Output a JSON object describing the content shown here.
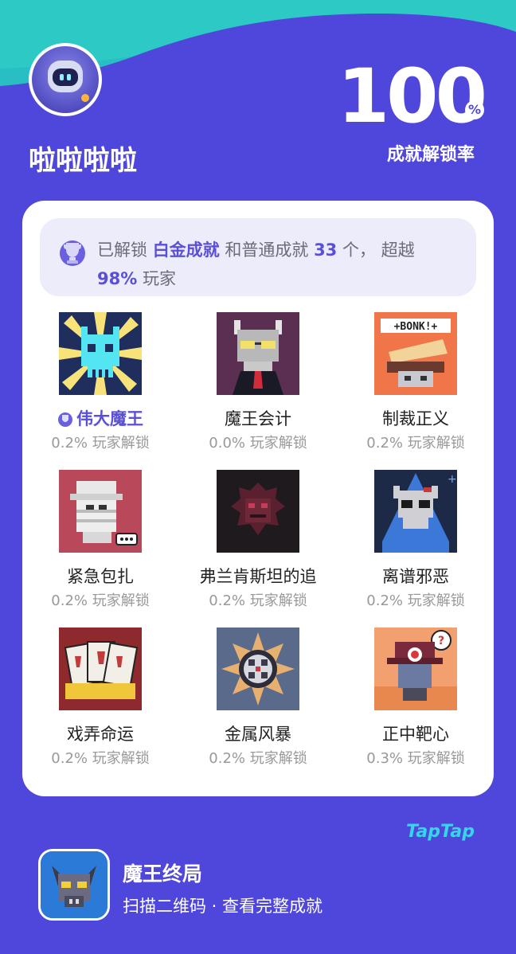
{
  "colors": {
    "background": "#4f46dc",
    "accent": "#5a4fd8",
    "teal": "#2dc9c5",
    "card": "#ffffff"
  },
  "profile": {
    "avatar_icon": "robot-avatar",
    "username": "啦啦啦啦"
  },
  "rate": {
    "value": "100",
    "unit": "%",
    "label": "成就解锁率"
  },
  "summary": {
    "icon": "trophy-icon",
    "t1": "已解锁",
    "highlight1": "白金成就",
    "t2": "和普通成就",
    "highlight2": "33",
    "t3": "个，",
    "t4": "超越",
    "highlight3": "98%",
    "t5": "玩家"
  },
  "achievements": [
    {
      "name": "伟大魔王",
      "pct": "0.2% 玩家解锁",
      "icon": "cyan-skull-icon",
      "platinum": true
    },
    {
      "name": "魔王会计",
      "pct": "0.0% 玩家解锁",
      "icon": "demon-accountant-icon"
    },
    {
      "name": "制裁正义",
      "pct": "0.2% 玩家解锁",
      "icon": "bonk-hammer-icon"
    },
    {
      "name": "紧急包扎",
      "pct": "0.2% 玩家解锁",
      "icon": "mummy-icon"
    },
    {
      "name": "弗兰肯斯坦的追",
      "pct": "0.2% 玩家解锁",
      "icon": "dark-demon-icon"
    },
    {
      "name": "离谱邪恶",
      "pct": "0.2% 玩家解锁",
      "icon": "hooded-skull-icon"
    },
    {
      "name": "戏弄命运",
      "pct": "0.2% 玩家解锁",
      "icon": "playing-cards-icon"
    },
    {
      "name": "金属风暴",
      "pct": "0.2% 玩家解锁",
      "icon": "metal-gear-icon"
    },
    {
      "name": "正中靶心",
      "pct": "0.3% 玩家解锁",
      "icon": "target-hat-icon"
    }
  ],
  "brand": {
    "taptap": "TapTap"
  },
  "footer": {
    "game_icon": "demon-king-game-icon",
    "title": "魔王终局",
    "subtitle": "扫描二维码 · 查看完整成就"
  }
}
